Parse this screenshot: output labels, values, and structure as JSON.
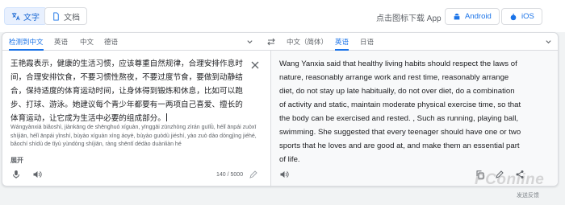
{
  "topbar": {
    "text_mode_label": "文字",
    "document_mode_label": "文档",
    "download_label": "点击图标下载 App",
    "android_label": "Android",
    "ios_label": "iOS"
  },
  "source": {
    "tabs": [
      "检测到中文",
      "英语",
      "中文",
      "德语"
    ],
    "text": "王艳霞表示，健康的生活习惯，应该尊重自然规律，合理安排作息时间，合理安排饮食，不要习惯性熬夜，不要过度节食，要做到动静结合，保持适度的体育运动时间，让身体得到锻炼和休息，比如可以跑步、打球、游泳。她建议每个青少年都要有一两项自己喜爱、擅长的体育运动，让它成为生活中必要的组成部分。",
    "pinyin": "Wángyànxiá biǎoshì, jiànkāng de shēnghuó xíguàn, yīnggāi zūnzhòng zìrán guīlǜ, hélǐ ānpái zuòxī shíjiān, hélǐ ānpái yǐnshí, bùyào xíguàn xìng áoyè, bùyào guòdù jiéshí, yào zuò dào dòngjìng jiéhé, bǎochí shìdù de tǐyù yùndòng shíjiān, ràng shēntǐ dédào duànliàn hé",
    "expand_label": "展开",
    "char_count": "140 / 5000"
  },
  "target": {
    "tabs": [
      "中文（简体）",
      "英语",
      "日语"
    ],
    "text": "Wang Yanxia said that healthy living habits should respect the laws of nature, reasonably arrange work and rest time, reasonably arrange diet, do not stay up late habitually, do not over diet, do a combination of activity and static, maintain moderate physical exercise time, so that the body can be exercised and rested. , Such as running, playing ball, swimming. She suggested that every teenager should have one or two sports that he loves and are good at, and make them an essential part of life.",
    "feedback_label": "发送反馈"
  },
  "watermark": "PConline",
  "colors": {
    "accent": "#1a73e8",
    "border": "#dadce0",
    "muted": "#5f6368"
  }
}
